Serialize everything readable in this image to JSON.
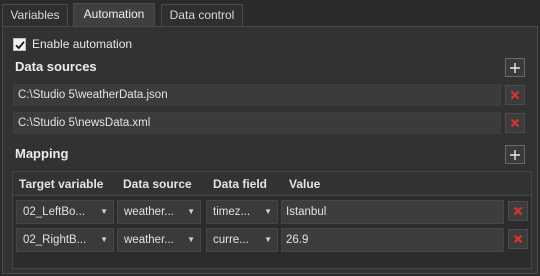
{
  "tabs": [
    {
      "label": "Variables",
      "active": false
    },
    {
      "label": "Automation",
      "active": true
    },
    {
      "label": "Data control",
      "active": false
    }
  ],
  "enable_automation": {
    "label": "Enable automation",
    "checked": true
  },
  "data_sources": {
    "heading": "Data sources",
    "add_icon": "plus-icon",
    "items": [
      {
        "path": "C:\\Studio 5\\weatherData.json"
      },
      {
        "path": "C:\\Studio 5\\newsData.xml"
      }
    ]
  },
  "mapping": {
    "heading": "Mapping",
    "add_icon": "plus-icon",
    "columns": [
      "Target variable",
      "Data source",
      "Data field",
      "Value"
    ],
    "rows": [
      {
        "target": "02_LeftBo...",
        "source": "weather...",
        "field": "timez...",
        "value": "Istanbul"
      },
      {
        "target": "02_RightB...",
        "source": "weather...",
        "field": "curre...",
        "value": "26.9"
      }
    ]
  },
  "colors": {
    "background": "#2b2b2b",
    "panel": "#323232",
    "delete_icon": "#d9342b",
    "checkbox": "#f2f2f2"
  }
}
